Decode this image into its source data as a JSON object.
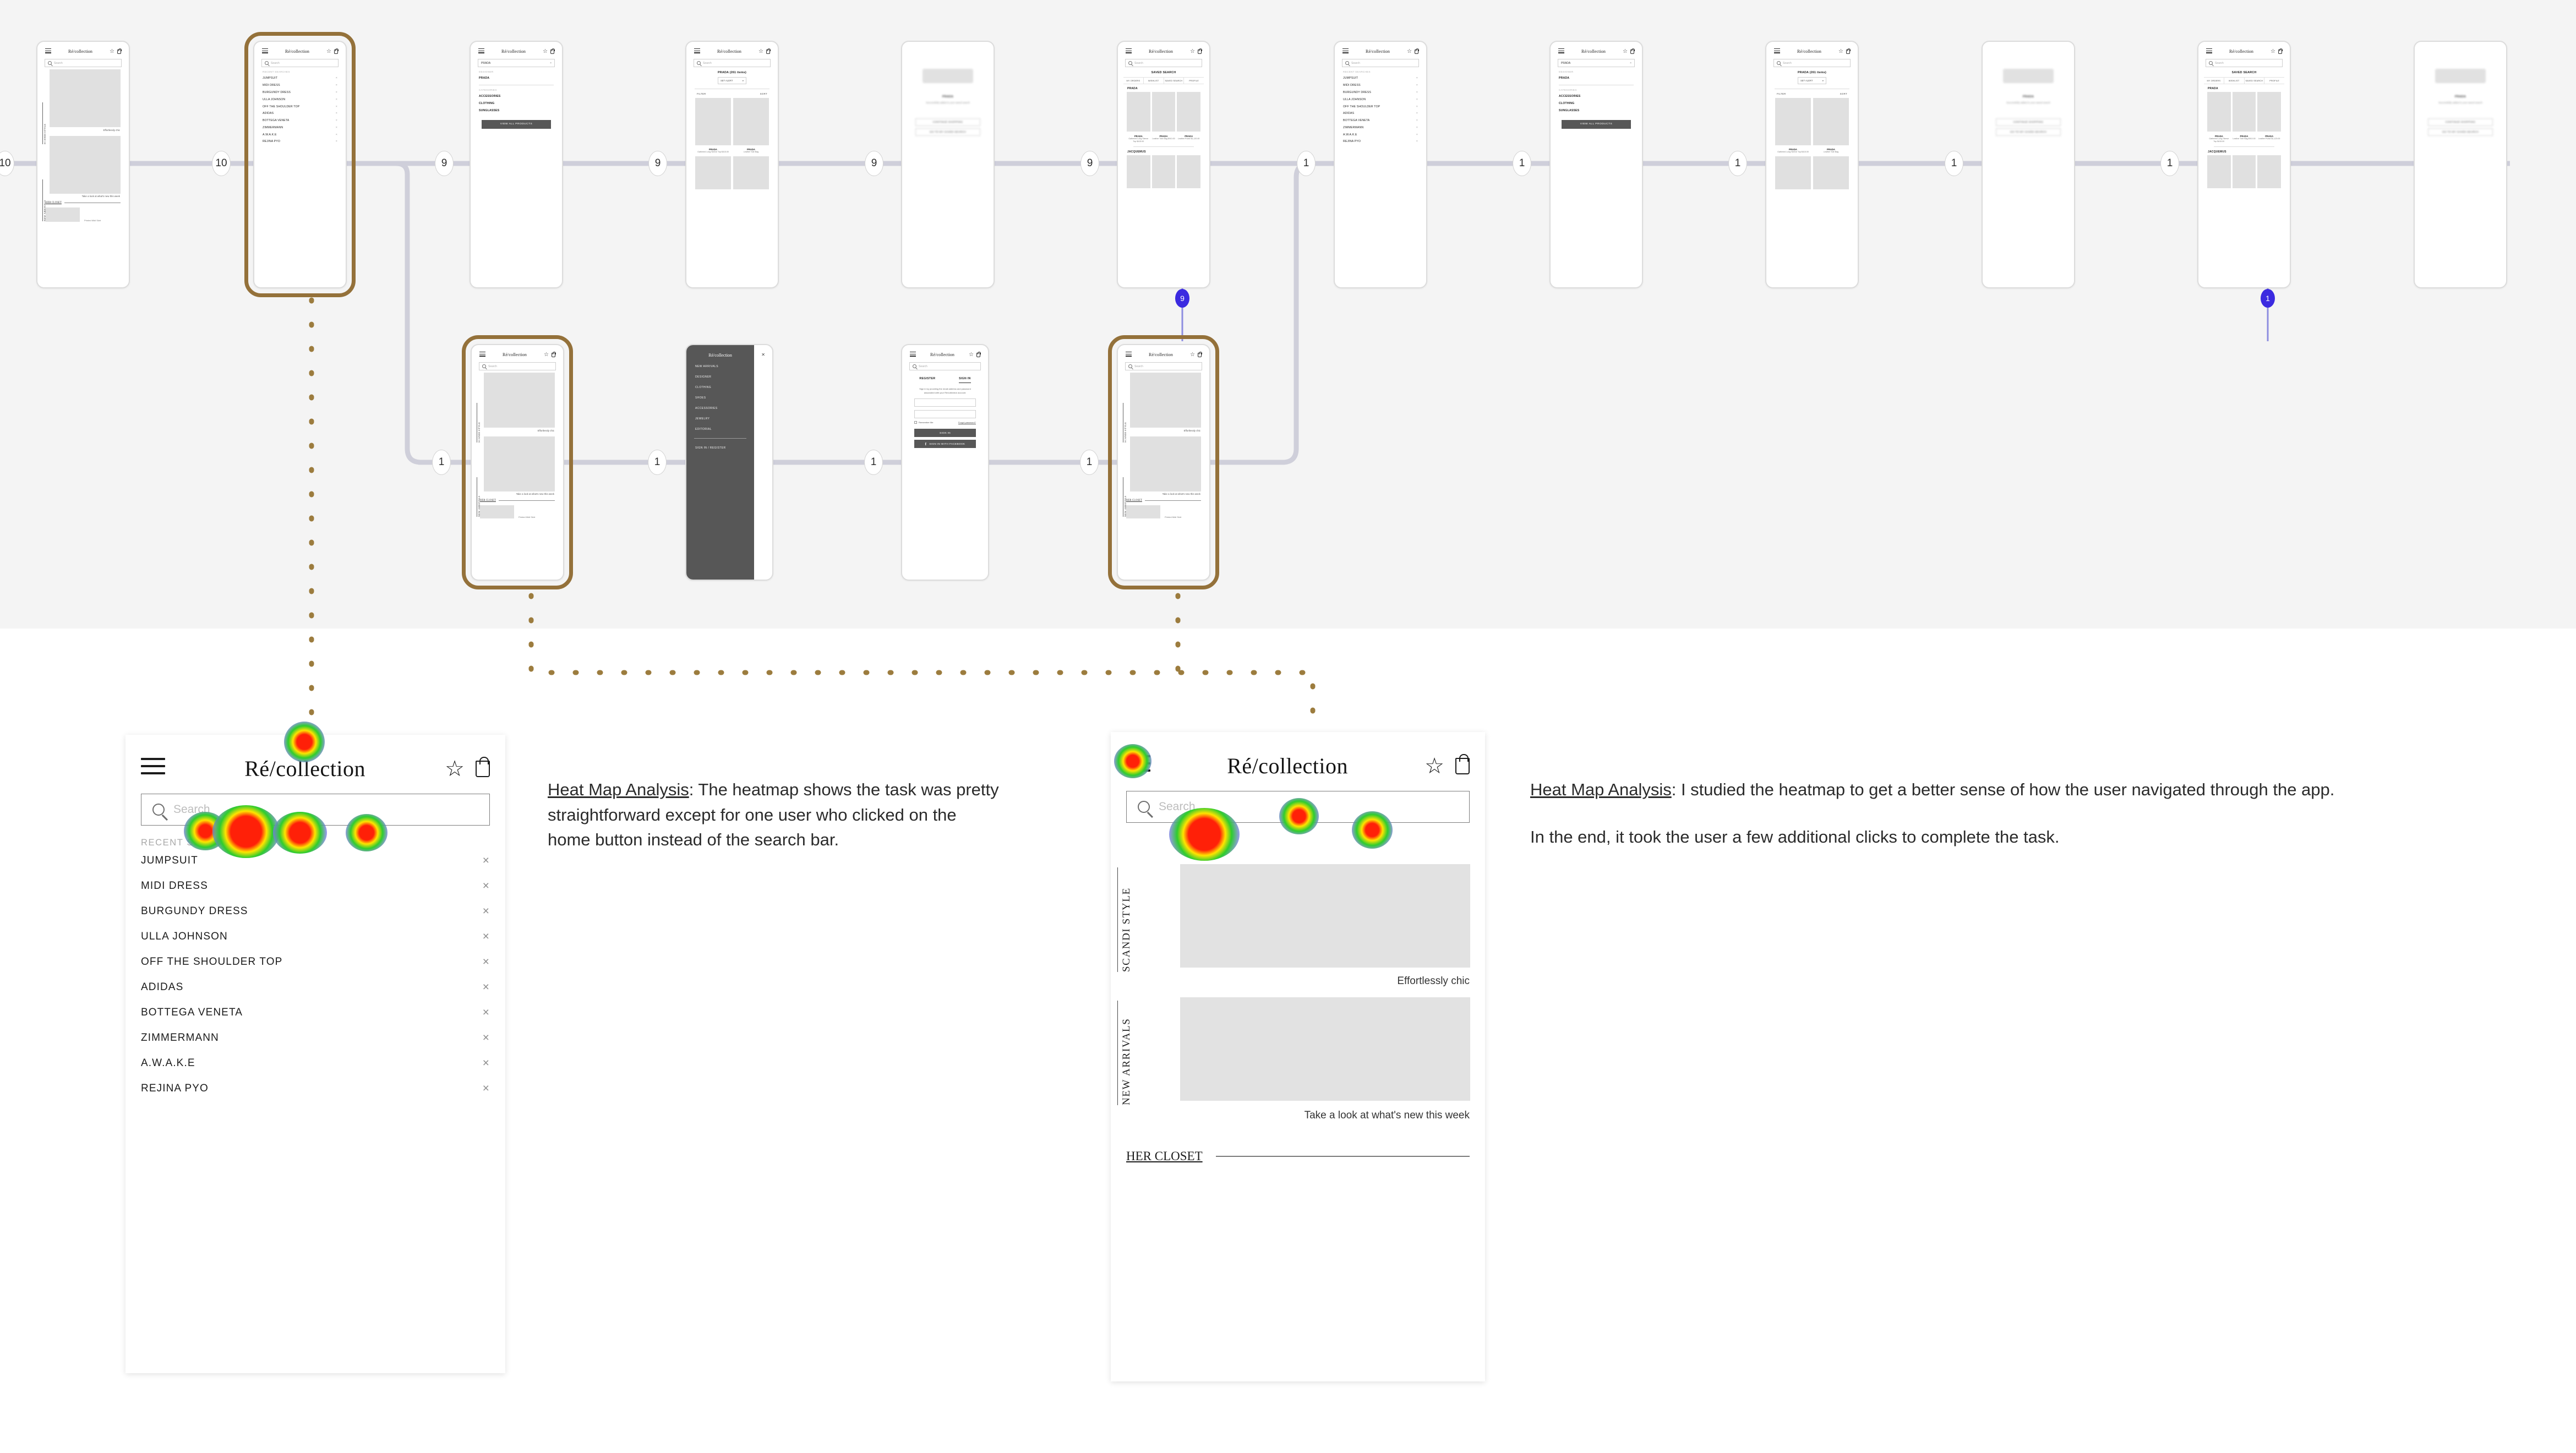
{
  "flow": {
    "steps": [
      "10",
      "10",
      "9",
      "9",
      "9",
      "9",
      "1",
      "1",
      "1",
      "1",
      "1"
    ],
    "steps_row2": [
      "1",
      "1",
      "1",
      "1"
    ],
    "badges": [
      {
        "value": "9"
      },
      {
        "value": "1"
      }
    ]
  },
  "app": {
    "logo": "Ré/collection",
    "search_placeholder": "Search",
    "search_query": "PRADA",
    "recent_label": "RECENT SEARCHES",
    "recent_searches": [
      "JUMPSUIT",
      "MIDI DRESS",
      "BURGUNDY DRESS",
      "ULLA JOHNSON",
      "OFF THE SHOULDER TOP",
      "ADIDAS",
      "BOTTEGA VENETA",
      "ZIMMERMANN",
      "A.W.A.K.E",
      "REJINA PYO"
    ],
    "clear_icon": "×",
    "home": {
      "section1_label": "SCANDI STYLE",
      "section1_caption": "Effortlessly chic",
      "section2_label": "NEW ARRIVALS",
      "section2_caption": "Take a look at what's new this week",
      "footer_label": "HER CLOSET",
      "footer_caption": "Printed Midi Skirt"
    },
    "suggest": {
      "designer_label": "DESIGNER",
      "designer": "PRADA",
      "categories_label": "CATEGORIES",
      "categories": [
        "ACCESSORIES",
        "CLOTHING",
        "SUNGLASSES"
      ],
      "cta": "VIEW ALL PRODUCTS"
    },
    "results": {
      "heading": "PRADA (261 items)",
      "select": "SET ALERT",
      "filter": "FILTER",
      "sort": "SORT",
      "products": [
        {
          "brand": "PRADA",
          "desc": "Gathered Long Sleeve Top $415.00",
          "price": "$315.00"
        },
        {
          "brand": "PRADA",
          "desc": "Leather Tote Bag",
          "price": "$910.00"
        }
      ]
    },
    "confirm": {
      "title": "PRADA",
      "message": "Successfully added to your saved search",
      "btn_continue": "CONTINUE SHOPPING",
      "btn_saved": "GO TO MY SAVED SEARCH"
    },
    "saved": {
      "title": "SAVED SEARCH",
      "tabs": [
        "MY ORDERS",
        "WISHLIST",
        "SAVED SEARCH",
        "PROFILE"
      ],
      "group1": "PRADA",
      "group2": "JACQUEMUS",
      "items": [
        {
          "brand": "PRADA",
          "desc": "Gathered Long Sleeve Top $415.00"
        },
        {
          "brand": "PRADA",
          "desc": "Leather Tote Bag $910.00"
        },
        {
          "brand": "PRADA",
          "desc": "Leather Purse $1,120.00"
        }
      ]
    },
    "drawer": {
      "items": [
        "NEW ARRIVALS",
        "DESIGNER",
        "CLOTHING",
        "SHOES",
        "ACCESSORIES",
        "JEWELRY",
        "EDITORIAL"
      ],
      "account": "SIGN IN / REGISTER",
      "close": "✕"
    },
    "auth": {
      "tab_register": "REGISTER",
      "tab_signin": "SIGN IN",
      "intro": "Sign in by providing the email address and password associated with your Ré/collection account.",
      "remember": "Remember Me",
      "forgot": "Forgot password?",
      "submit": "SIGN IN",
      "facebook": "SIGN IN WITH FACEBOOK"
    }
  },
  "analysis_left": {
    "heading": "Heat Map Analysis",
    "body": ": The heatmap shows the task was pretty straightforward except for one user who clicked on the home button instead of the search bar."
  },
  "analysis_right": {
    "heading": "Heat Map Analysis",
    "body": ": I studied the heatmap to get a better sense of how the user navigated through the app.",
    "body2": "In the end, it took the user a few additional clicks to complete the task."
  },
  "colors": {
    "selection": "#94713a",
    "badge_blue": "#3b2ae0",
    "canvas_bg": "#f4f4f4",
    "connector": "#cfcfda",
    "heat_hot": "#ff2a0a",
    "heat_mid": "#ffe800",
    "heat_cool": "#15cc20",
    "heat_halo": "#7a7ae8"
  }
}
